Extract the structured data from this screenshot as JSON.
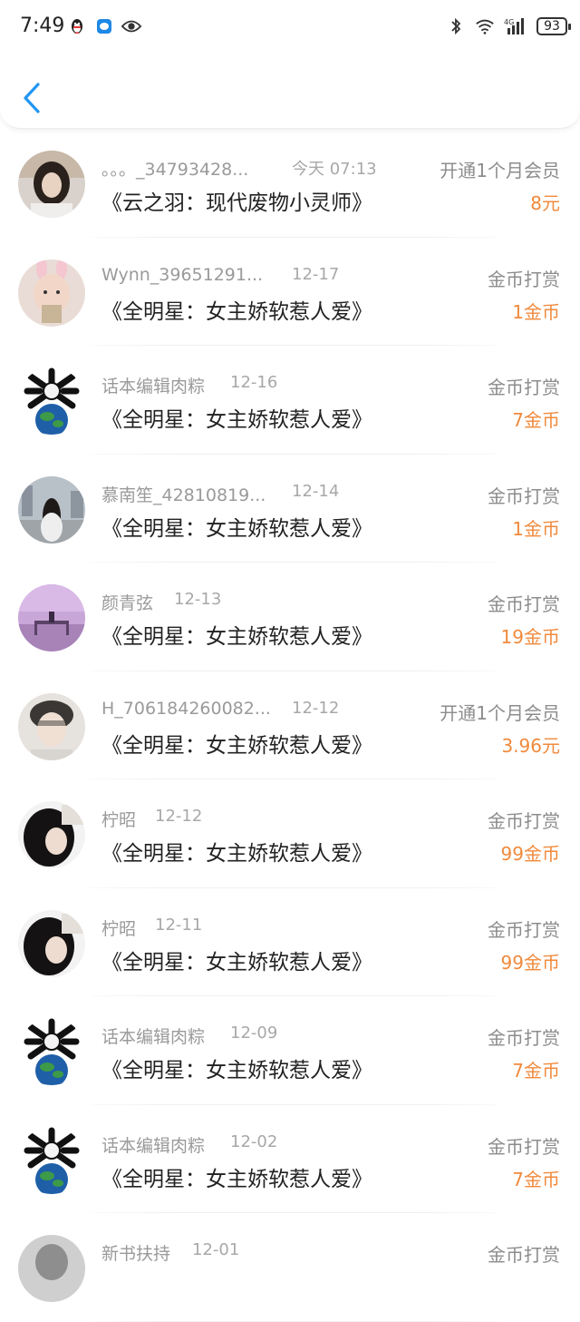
{
  "status_bar": {
    "time": "7:49",
    "battery": "93",
    "network": "4G"
  },
  "colors": {
    "accent_blue": "#2196F3",
    "amount_orange": "#F08A3C"
  },
  "records": [
    {
      "name": "。。。_34793428...",
      "date": "今天 07:13",
      "type": "开通1个月会员",
      "book": "《云之羽：现代废物小灵师》",
      "amount": "8元",
      "avatar": "girl-photo"
    },
    {
      "name": "Wynn_39651291...",
      "date": "12-17",
      "type": "金币打赏",
      "book": "《全明星：女主娇软惹人爱》",
      "amount": "1金币",
      "avatar": "baby-bunny-photo"
    },
    {
      "name": "话本编辑肉粽",
      "date": "12-16",
      "type": "金币打赏",
      "book": "《全明星：女主娇软惹人爱》",
      "amount": "7金币",
      "avatar": "globe-logo"
    },
    {
      "name": "慕南笙_42810819...",
      "date": "12-14",
      "type": "金币打赏",
      "book": "《全明星：女主娇软惹人爱》",
      "amount": "1金币",
      "avatar": "street-girl-photo"
    },
    {
      "name": "颜青弦",
      "date": "12-13",
      "type": "金币打赏",
      "book": "《全明星：女主娇软惹人爱》",
      "amount": "19金币",
      "avatar": "sunset-pier-photo"
    },
    {
      "name": "H_706184260082...",
      "date": "12-12",
      "type": "开通1个月会员",
      "book": "《全明星：女主娇软惹人爱》",
      "amount": "3.96元",
      "avatar": "boy-photo"
    },
    {
      "name": "柠昭",
      "date": "12-12",
      "type": "金币打赏",
      "book": "《全明星：女主娇软惹人爱》",
      "amount": "99金币",
      "avatar": "dark-hair-photo"
    },
    {
      "name": "柠昭",
      "date": "12-11",
      "type": "金币打赏",
      "book": "《全明星：女主娇软惹人爱》",
      "amount": "99金币",
      "avatar": "dark-hair-photo"
    },
    {
      "name": "话本编辑肉粽",
      "date": "12-09",
      "type": "金币打赏",
      "book": "《全明星：女主娇软惹人爱》",
      "amount": "7金币",
      "avatar": "globe-logo"
    },
    {
      "name": "话本编辑肉粽",
      "date": "12-02",
      "type": "金币打赏",
      "book": "《全明星：女主娇软惹人爱》",
      "amount": "7金币",
      "avatar": "globe-logo"
    },
    {
      "name": "新书扶持",
      "date": "12-01",
      "type": "金币打赏",
      "book": "",
      "amount": "",
      "avatar": "gray-photo"
    }
  ]
}
